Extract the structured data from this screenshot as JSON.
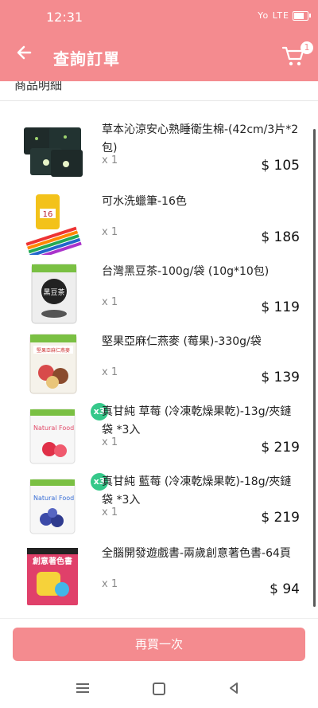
{
  "status": {
    "time": "12:31",
    "signal_text": "Yo LTE"
  },
  "header": {
    "title": "查詢訂單",
    "cart_count": "1"
  },
  "section": {
    "title": "商品明細"
  },
  "items": [
    {
      "name": "草本沁涼安心熟睡衛生棉-(42cm/3片*2包)",
      "qty": "x 1",
      "price": "$ 105"
    },
    {
      "name": "可水洗蠟筆-16色",
      "qty": "x 1",
      "price": "$ 186",
      "thumb_label": "16"
    },
    {
      "name": "台灣黑豆茶-100g/袋 (10g*10包)",
      "qty": "x 1",
      "price": "$ 119",
      "thumb_label": "黑豆茶"
    },
    {
      "name": "堅果亞麻仁燕麥 (莓果)-330g/袋",
      "qty": "x 1",
      "price": "$ 139",
      "thumb_label": "堅果亞麻仁燕麥"
    },
    {
      "name": "真甘純 草莓 (冷凍乾燥果乾)-13g/夾鏈袋 *3入",
      "qty": "x 1",
      "price": "$ 219",
      "badge": "x3",
      "thumb_label": "Natural Food"
    },
    {
      "name": "真甘純 藍莓 (冷凍乾燥果乾)-18g/夾鏈袋 *3入",
      "qty": "x 1",
      "price": "$ 219",
      "badge": "x3",
      "thumb_label": "Natural Food"
    },
    {
      "name": "全腦開發遊戲書-兩歲創意著色書-64頁",
      "qty": "x 1",
      "price": "$ 94",
      "thumb_label": "創意著色書"
    }
  ],
  "footer": {
    "rebuy_label": "再買一次"
  },
  "icons": {
    "back": "arrow-left-icon",
    "cart": "cart-icon",
    "nav_menu": "menu-icon",
    "nav_home": "home-icon",
    "nav_back": "triangle-back-icon"
  },
  "colors": {
    "accent": "#f48b8f",
    "badge_green": "#35c88a"
  }
}
